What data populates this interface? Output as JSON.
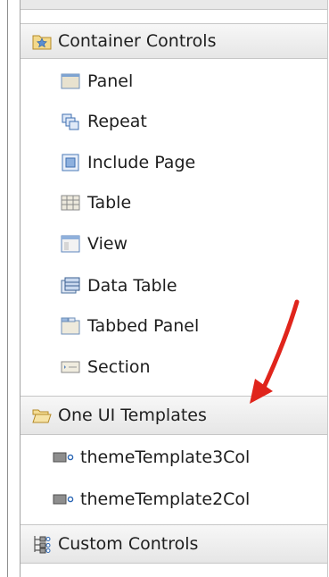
{
  "palette": {
    "drawers": [
      {
        "label": "Container Controls",
        "icon": "folder-star-icon"
      },
      {
        "label": "One UI Templates",
        "icon": "open-folder-icon"
      },
      {
        "label": "Custom Controls",
        "icon": "custom-controls-icon"
      }
    ],
    "container_items": [
      {
        "label": "Panel",
        "icon": "panel-icon"
      },
      {
        "label": "Repeat",
        "icon": "repeat-icon"
      },
      {
        "label": "Include Page",
        "icon": "include-page-icon"
      },
      {
        "label": "Table",
        "icon": "table-icon"
      },
      {
        "label": "View",
        "icon": "view-icon"
      },
      {
        "label": "Data Table",
        "icon": "data-table-icon"
      },
      {
        "label": "Tabbed Panel",
        "icon": "tabbed-panel-icon"
      },
      {
        "label": "Section",
        "icon": "section-icon"
      }
    ],
    "template_items": [
      {
        "label": "themeTemplate3Col",
        "icon": "custom-control-icon"
      },
      {
        "label": "themeTemplate2Col",
        "icon": "custom-control-icon"
      }
    ]
  },
  "colors": {
    "annotation_arrow": "#e0251c"
  }
}
